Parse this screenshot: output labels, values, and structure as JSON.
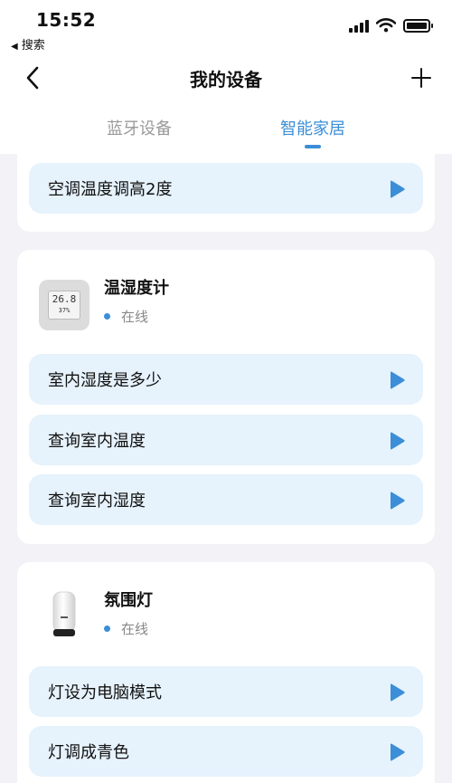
{
  "status_bar": {
    "time": "15:52",
    "back_app": "搜索"
  },
  "nav": {
    "title": "我的设备"
  },
  "tabs": [
    {
      "label": "蓝牙设备",
      "active": false
    },
    {
      "label": "智能家居",
      "active": true
    }
  ],
  "top_card": {
    "commands": [
      {
        "label": "空调温度调高2度"
      }
    ]
  },
  "devices": [
    {
      "name": "温湿度计",
      "status": "在线",
      "thumb_readout": "26.8",
      "thumb_readout_small": "37%",
      "commands": [
        {
          "label": "室内湿度是多少"
        },
        {
          "label": "查询室内温度"
        },
        {
          "label": "查询室内湿度"
        }
      ]
    },
    {
      "name": "氛围灯",
      "status": "在线",
      "commands": [
        {
          "label": "灯设为电脑模式"
        },
        {
          "label": "灯调成青色"
        }
      ]
    }
  ],
  "colors": {
    "accent": "#3b8ed7",
    "command_bg": "#e6f2fc",
    "page_bg": "#f2f2f7"
  }
}
